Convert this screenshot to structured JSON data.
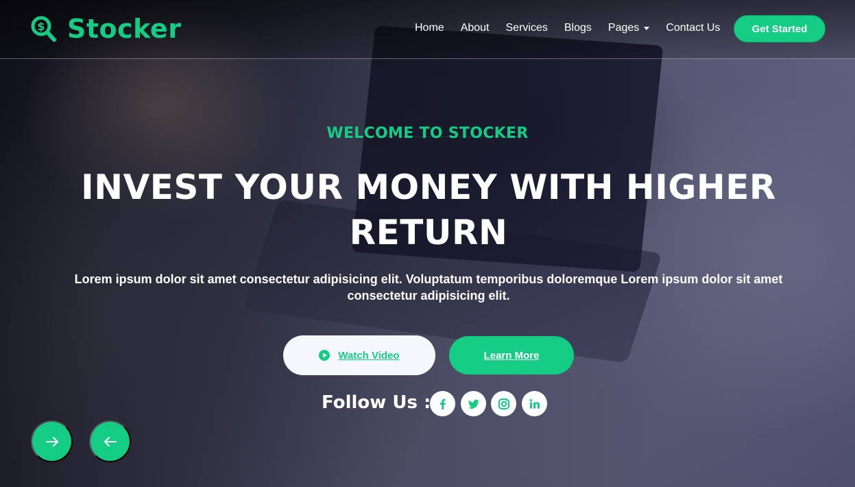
{
  "brand": {
    "name": "Stocker",
    "icon": "search-dollar-icon"
  },
  "nav": {
    "links": [
      "Home",
      "About",
      "Services",
      "Blogs",
      "Pages",
      "Contact Us"
    ],
    "cta_label": "Get Started"
  },
  "hero": {
    "subtitle": "WELCOME TO STOCKER",
    "title_line1": "INVEST YOUR MONEY WITH HIGHER",
    "title_line2": "RETURN",
    "description": "Lorem ipsum dolor sit amet consectetur adipisicing elit. Voluptatum temporibus doloremque Lorem ipsum dolor sit amet consectetur adipisicing elit.",
    "watch_label": "Watch Video",
    "learn_label": "Learn More",
    "follow_label": "Follow Us :"
  },
  "social": [
    "facebook-icon",
    "twitter-icon",
    "instagram-icon",
    "linkedin-icon"
  ],
  "carousel": {
    "next_icon": "arrow-right-icon",
    "prev_icon": "arrow-left-icon"
  },
  "colors": {
    "accent": "#15cc84",
    "button_light": "#f6f7fa",
    "text": "#ffffff"
  }
}
